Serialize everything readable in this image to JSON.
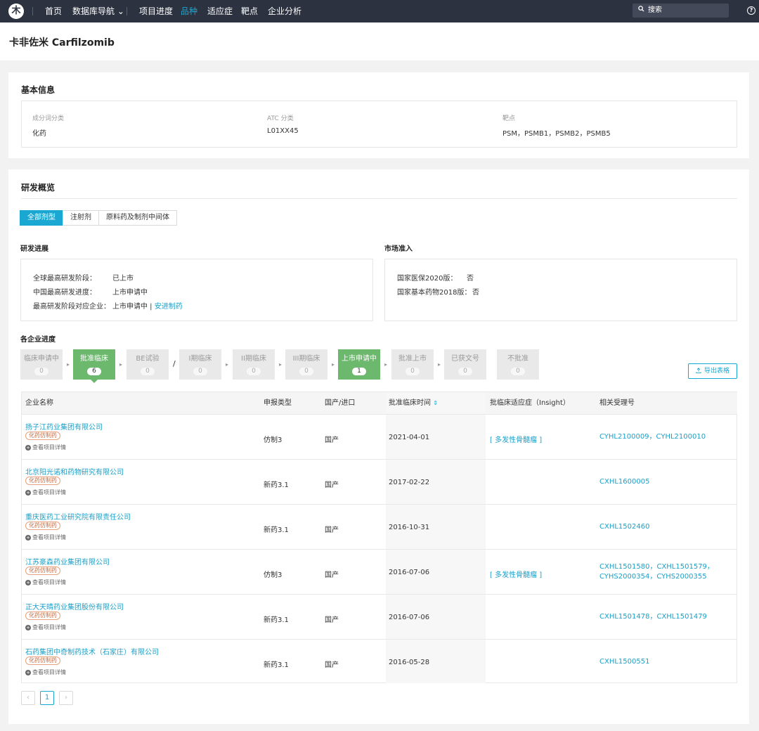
{
  "nav": {
    "logo": "木",
    "items": [
      "首页",
      "数据库导航 ⌄",
      "项目进度",
      "品种",
      "适应症",
      "靶点",
      "企业分析"
    ],
    "search_placeholder": "搜索"
  },
  "page_title": "卡非佐米 Carfilzomib",
  "basic": {
    "title": "基本信息",
    "fields": [
      {
        "label": "成分词分类",
        "value": "化药"
      },
      {
        "label": "ATC 分类",
        "value": "L01XX45"
      },
      {
        "label": "靶点",
        "value": "PSM，PSMB1，PSMB2，PSMB5"
      }
    ]
  },
  "rd": {
    "title": "研发概览",
    "tabs": [
      "全部剂型",
      "注射剂",
      "原料药及制剂中间体"
    ],
    "progress": {
      "title": "研发进展",
      "rows": [
        {
          "k": "全球最高研发阶段：",
          "v": "已上市"
        },
        {
          "k": "中国最高研发进度：",
          "v": "上市申请中"
        },
        {
          "k": "最高研发阶段对应企业：",
          "v": "上市申请中 | ",
          "link": "安进制药"
        }
      ]
    },
    "market": {
      "title": "市场准入",
      "rows": [
        {
          "k": "国家医保2020版：",
          "v": "否"
        },
        {
          "k": "国家基本药物2018版：",
          "v": "否"
        }
      ]
    },
    "company_title": "各企业进度",
    "stages": [
      {
        "name": "临床申请中",
        "count": "0"
      },
      {
        "name": "批准临床",
        "count": "6"
      },
      {
        "name": "BE试验",
        "count": "0"
      },
      {
        "name": "I期临床",
        "count": "0"
      },
      {
        "name": "II期临床",
        "count": "0"
      },
      {
        "name": "III期临床",
        "count": "0"
      },
      {
        "name": "上市申请中",
        "count": "1"
      },
      {
        "name": "批准上市",
        "count": "0"
      },
      {
        "name": "已获文号",
        "count": "0"
      },
      {
        "name": "不批准",
        "count": "0"
      }
    ],
    "slash": "/",
    "export": "导出表格",
    "table": {
      "headers": [
        "企业名称",
        "申报类型",
        "国产/进口",
        "批准临床时间",
        "批临床适应症（Insight）",
        "相关受理号"
      ],
      "rows": [
        {
          "company": "扬子江药业集团有限公司",
          "tag": "化药仿制药",
          "more": "查看项目详情",
          "type": "仿制3",
          "origin": "国产",
          "date": "2021-04-01",
          "indication": "[ 多发性骨髓瘤 ]",
          "acc1": "CYHL2100009，CYHL2100010",
          "acc2": ""
        },
        {
          "company": "北京阳光诺和药物研究有限公司",
          "tag": "化药仿制药",
          "more": "查看项目详情",
          "type": "新药3.1",
          "origin": "国产",
          "date": "2017-02-22",
          "indication": "",
          "acc1": "CXHL1600005",
          "acc2": ""
        },
        {
          "company": "重庆医药工业研究院有限责任公司",
          "tag": "化药仿制药",
          "more": "查看项目详情",
          "type": "新药3.1",
          "origin": "国产",
          "date": "2016-10-31",
          "indication": "",
          "acc1": "CXHL1502460",
          "acc2": ""
        },
        {
          "company": "江苏豪森药业集团有限公司",
          "tag": "化药仿制药",
          "more": "查看项目详情",
          "type": "仿制3",
          "origin": "国产",
          "date": "2016-07-06",
          "indication": "[ 多发性骨髓瘤 ]",
          "acc1": "CXHL1501580，CXHL1501579，",
          "acc2": "CYHS2000354，CYHS2000355"
        },
        {
          "company": "正大天晴药业集团股份有限公司",
          "tag": "化药仿制药",
          "more": "查看项目详情",
          "type": "新药3.1",
          "origin": "国产",
          "date": "2016-07-06",
          "indication": "",
          "acc1": "CXHL1501478，CXHL1501479",
          "acc2": ""
        },
        {
          "company": "石药集团中奇制药技术（石家庄）有限公司",
          "tag": "化药仿制药",
          "more": "查看项目详情",
          "type": "新药3.1",
          "origin": "国产",
          "date": "2016-05-28",
          "indication": "",
          "acc1": "CXHL1500551",
          "acc2": ""
        }
      ]
    },
    "pager": {
      "prev": "‹",
      "current": "1",
      "next": "›"
    }
  }
}
